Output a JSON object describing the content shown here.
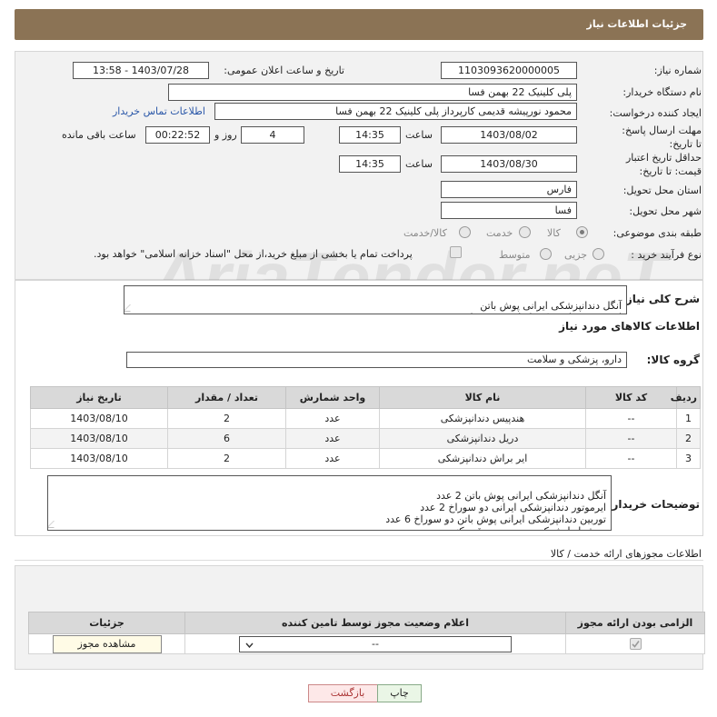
{
  "header": {
    "title": "جزئیات اطلاعات نیاز"
  },
  "need": {
    "need_number_label": "شماره نیاز:",
    "need_number": "1103093620000005",
    "announce_label": "تاریخ و ساعت اعلان عمومی:",
    "announce_value": "1403/07/28 - 13:58",
    "buyer_org_label": "نام دستگاه خریدار:",
    "buyer_org": "پلی کلینیک 22 بهمن فسا",
    "creator_label": "ایجاد کننده درخواست:",
    "creator": "محمود نورپیشه قدیمی کارپرداز پلی کلینیک 22 بهمن فسا",
    "contact_link": "اطلاعات تماس خریدار",
    "deadline_label": "مهلت ارسال پاسخ: تا تاریخ:",
    "deadline_date": "1403/08/02",
    "time_label": "ساعت",
    "deadline_time": "14:35",
    "days_value": "4",
    "days_label": "روز و",
    "remaining_time": "00:22:52",
    "remaining_label": "ساعت باقی مانده",
    "price_validity_label": "حداقل تاریخ اعتبار قیمت: تا تاریخ:",
    "price_validity_date": "1403/08/30",
    "price_validity_time": "14:35",
    "province_label": "استان محل تحویل:",
    "province": "فارس",
    "city_label": "شهر محل تحویل:",
    "city": "فسا",
    "category_label": "طبقه بندی موضوعی:",
    "category_options": [
      "کالا",
      "خدمت",
      "کالا/خدمت"
    ],
    "process_label": "نوع فرآیند خرید :",
    "process_options": [
      "جزیی",
      "متوسط"
    ],
    "payment_note": "پرداخت تمام یا بخشی از مبلغ خرید،از محل \"اسناد خزانه اسلامی\" خواهد بود."
  },
  "summary": {
    "label": "شرح کلی نیاز:",
    "text": "آنگل دندانپزشکی ایرانی پوش باتن\nایرموتور دندانپزشکی ایرانی  دو سوراخ"
  },
  "goods": {
    "section_title": "اطلاعات کالاهای مورد نیاز",
    "group_label": "گروه کالا:",
    "group_value": "دارو، پزشکی و سلامت",
    "columns": [
      "ردیف",
      "کد کالا",
      "نام کالا",
      "واحد شمارش",
      "تعداد / مقدار",
      "تاریخ نیاز"
    ],
    "rows": [
      {
        "idx": "1",
        "code": "--",
        "name": "هندپیس دندانپزشکی",
        "unit": "عدد",
        "qty": "2",
        "date": "1403/08/10"
      },
      {
        "idx": "2",
        "code": "--",
        "name": "دریل دندانپزشکی",
        "unit": "عدد",
        "qty": "6",
        "date": "1403/08/10"
      },
      {
        "idx": "3",
        "code": "--",
        "name": "ایر براش دندانپزشکی",
        "unit": "عدد",
        "qty": "2",
        "date": "1403/08/10"
      }
    ]
  },
  "buyer_notes": {
    "label": "توضیحات خریدار:",
    "text": "آنگل دندانپزشکی ایرانی پوش باتن 2 عدد\nایرموتور دندانپزشکی ایرانی  دو سوراخ 2 عدد\nتوربین دندانپزشکی ایرانی پوش باتن دو سوراخ 6 عدد\nبه شرایط شرکت در پیوست دقت کنید"
  },
  "permits": {
    "section_title": "اطلاعات مجوزهای ارائه خدمت / کالا",
    "columns": [
      "الزامی بودن ارائه مجوز",
      "اعلام وضعیت مجوز توسط تامین کننده",
      "جزئیات"
    ],
    "status_value": "--",
    "view_button": "مشاهده مجوز"
  },
  "actions": {
    "print": "چاپ",
    "back": "بازگشت"
  },
  "watermark": {
    "text": "AriaTender.neT"
  },
  "colors": {
    "header_bg": "#8b7355",
    "link": "#2a57a8",
    "back_btn": "#fde8e8",
    "print_btn": "#eaf6e6"
  }
}
